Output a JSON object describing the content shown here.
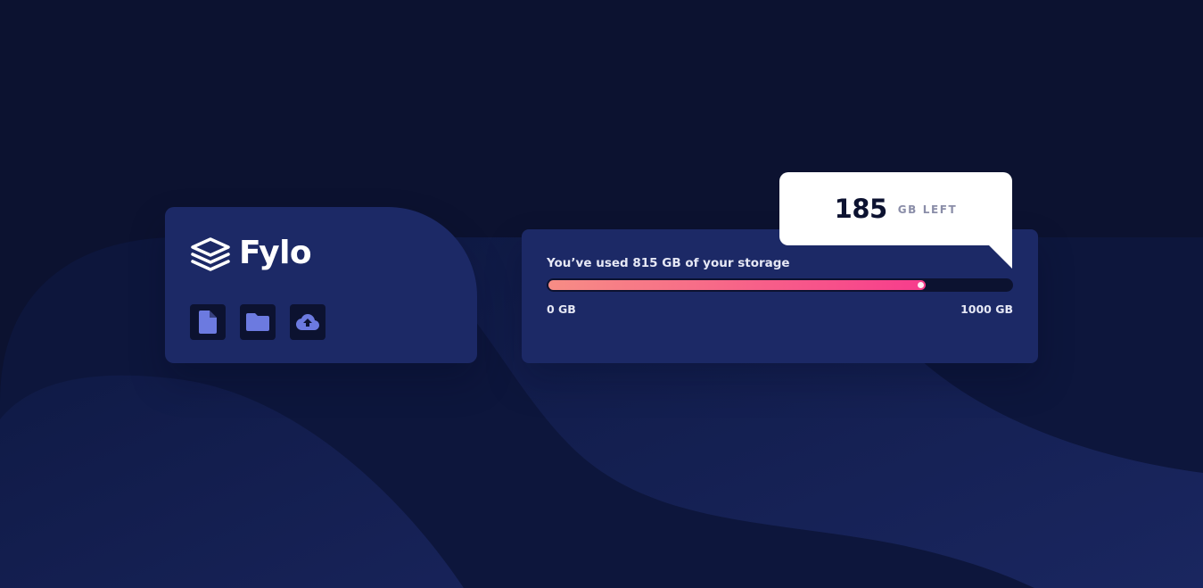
{
  "background": {
    "colors": {
      "base": "#0c1230",
      "wave": "#1c2966"
    }
  },
  "brand": {
    "logo_text": "Fylo",
    "logo_icon": "stacked-layers-icon"
  },
  "actions": [
    {
      "icon": "document-icon"
    },
    {
      "icon": "folder-icon"
    },
    {
      "icon": "cloud-upload-icon"
    }
  ],
  "storage": {
    "usage_text": "You’ve used 815 GB of your storage",
    "used_gb": 815,
    "total_gb": 1000,
    "min_label": "0 GB",
    "max_label": "1000 GB",
    "gradient": {
      "from": "#f78d85",
      "to": "#f73c8c"
    }
  },
  "callout": {
    "remaining_value": "185",
    "remaining_unit": "GB LEFT"
  }
}
